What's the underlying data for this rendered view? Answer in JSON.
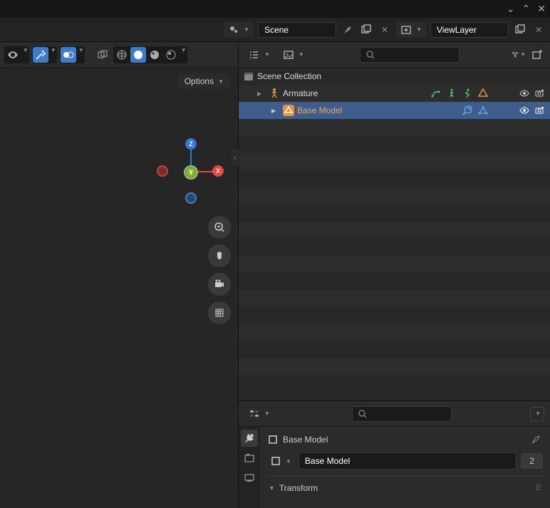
{
  "window": {
    "minimize": "⌄",
    "maximize": "⌃",
    "close": "✕"
  },
  "topbar": {
    "scene_label": "Scene",
    "viewlayer_label": "ViewLayer"
  },
  "viewport": {
    "options_label": "Options",
    "axes": {
      "x": "X",
      "y": "Y",
      "z": "Z"
    }
  },
  "outliner": {
    "search_placeholder": "",
    "collection": "Scene Collection",
    "items": [
      {
        "name": "Armature",
        "selected": false,
        "type": "armature"
      },
      {
        "name": "Base Model",
        "selected": true,
        "type": "mesh"
      }
    ]
  },
  "properties": {
    "breadcrumb_name": "Base Model",
    "object_name": "Base Model",
    "users": "2",
    "transform_panel": "Transform"
  }
}
